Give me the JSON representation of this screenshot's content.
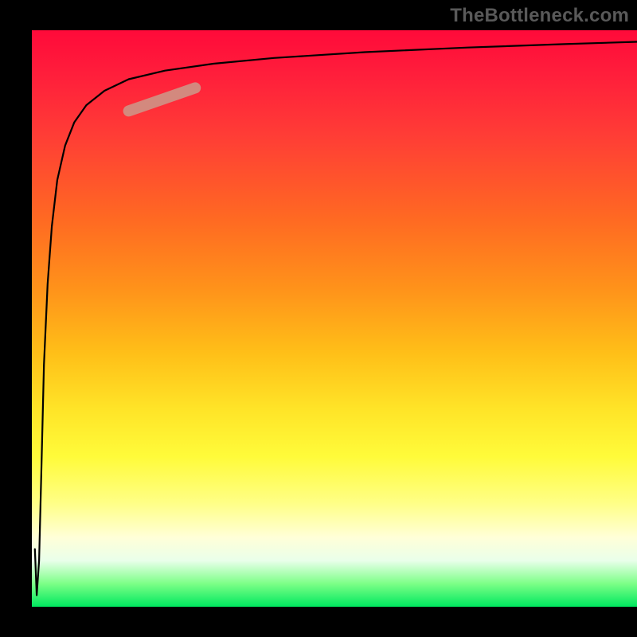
{
  "watermark": "TheBottleneck.com",
  "colors": {
    "frame": "#000000",
    "watermark_text": "#595959",
    "curve": "#000000",
    "highlight": "#cf9184",
    "gradient_stops": [
      "#ff0a3a",
      "#ff1f3b",
      "#ff3c36",
      "#ff6a22",
      "#ff931a",
      "#ffbf18",
      "#ffe528",
      "#fffb3a",
      "#ffff86",
      "#ffffd8",
      "#e9ffea",
      "#7cff87",
      "#00e85f"
    ]
  },
  "chart_data": {
    "type": "line",
    "title": "",
    "xlabel": "",
    "ylabel": "",
    "xlim": [
      0,
      100
    ],
    "ylim": [
      0,
      100
    ],
    "x": [
      0.5,
      0.8,
      1.2,
      1.6,
      2.0,
      2.6,
      3.3,
      4.2,
      5.5,
      7.0,
      9.0,
      12,
      16,
      22,
      30,
      40,
      55,
      72,
      88,
      100
    ],
    "values": [
      10,
      2,
      8,
      25,
      42,
      56,
      66,
      74,
      80,
      84,
      87,
      89.5,
      91.5,
      93,
      94.2,
      95.2,
      96.2,
      97,
      97.6,
      98
    ],
    "highlight_segment": {
      "x_start": 16,
      "x_end": 27,
      "y_start": 86,
      "y_end": 90
    }
  }
}
